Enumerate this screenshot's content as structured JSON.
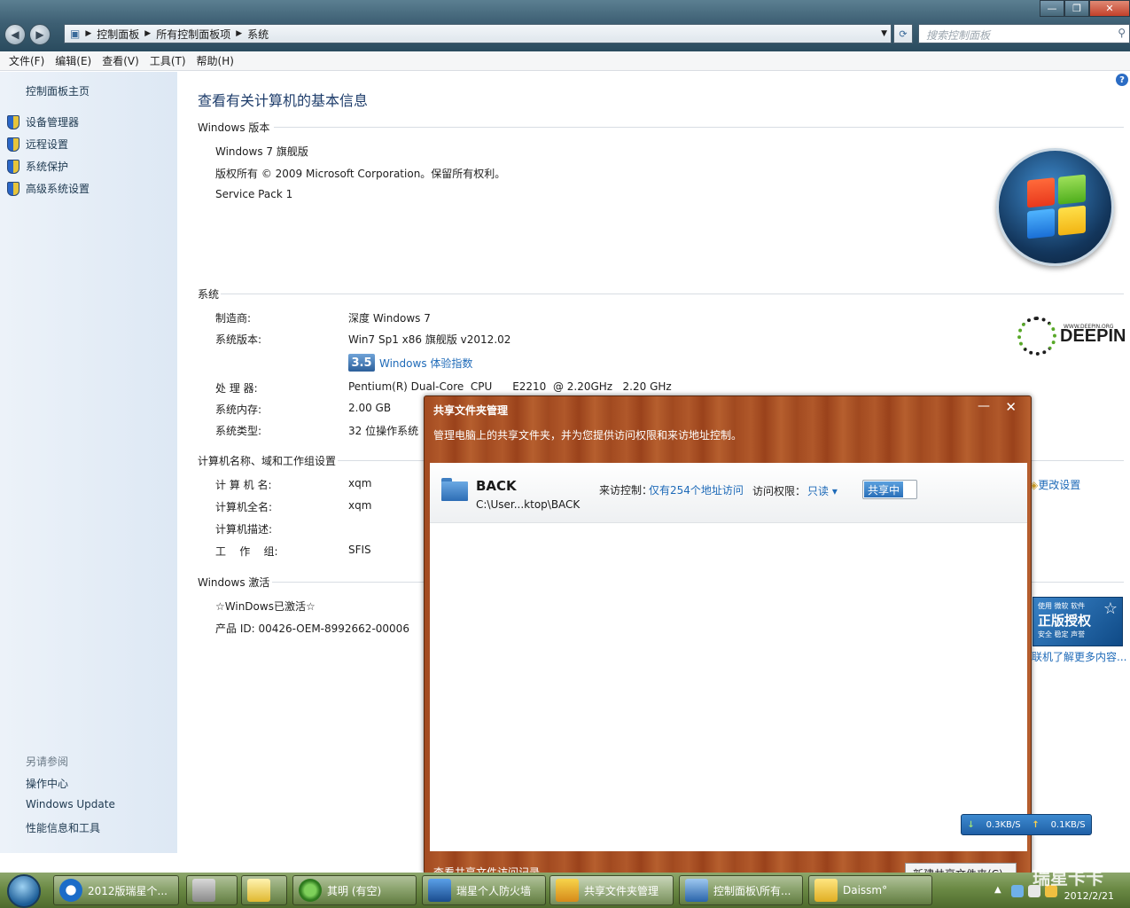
{
  "address": {
    "crumbs": [
      "控制面板",
      "所有控制面板项",
      "系统"
    ],
    "search_placeholder": "搜索控制面板"
  },
  "menu": [
    "文件(F)",
    "编辑(E)",
    "查看(V)",
    "工具(T)",
    "帮助(H)"
  ],
  "sidebar": {
    "home": "控制面板主页",
    "items": [
      "设备管理器",
      "远程设置",
      "系统保护",
      "高级系统设置"
    ],
    "see_also_head": "另请参阅",
    "see_also": [
      "操作中心",
      "Windows Update",
      "性能信息和工具"
    ]
  },
  "main": {
    "title": "查看有关计算机的基本信息",
    "edition": {
      "head": "Windows 版本",
      "name": "Windows 7 旗舰版",
      "copyright": "版权所有 © 2009 Microsoft Corporation。保留所有权利。",
      "sp": "Service Pack 1"
    },
    "system": {
      "head": "系统",
      "manufacturer_label": "制造商:",
      "manufacturer": "深度 Windows 7",
      "version_label": "系统版本:",
      "version": "Win7 Sp1 x86 旗舰版 v2012.02",
      "wei_score": "3.5",
      "wei_link": "Windows 体验指数",
      "cpu_label": "处 理 器:",
      "cpu": "Pentium(R) Dual-Core  CPU      E2210  @ 2.20GHz   2.20 GHz",
      "ram_label": "系统内存:",
      "ram": "2.00 GB",
      "type_label": "系统类型:",
      "type": "32 位操作系统"
    },
    "computer": {
      "head": "计算机名称、域和工作组设置",
      "name_label": "计 算 机 名:",
      "name": "xqm",
      "fullname_label": "计算机全名:",
      "fullname": "xqm",
      "desc_label": "计算机描述:",
      "workgroup_label": "工    作    组:",
      "workgroup": "SFIS",
      "change_link": "更改设置"
    },
    "activation": {
      "head": "Windows 激活",
      "status": "☆WinDows已激活☆",
      "product_id": "产品 ID: 00426-OEM-8992662-00006"
    },
    "deepin_text": "DEEPIN",
    "deepin_org": "WWW.DEEPIN.ORG",
    "genuine": {
      "line1": "使用 微软 软件",
      "line2": "正版授权",
      "line3": "安全 稳定 声誉"
    },
    "more_info": "联机了解更多内容..."
  },
  "dialog": {
    "title": "共享文件夹管理",
    "subtitle": "管理电脑上的共享文件夹，并为您提供访问权限和来访地址控制。",
    "share": {
      "name": "BACK",
      "path": "C:\\User...ktop\\BACK",
      "access_label": "来访控制：",
      "access_value": "仅有254个地址访问",
      "perm_label": "访问权限：",
      "perm_value": "只读 ▾",
      "status": "共享中"
    },
    "bottom_link": "查看共享文件访问记录",
    "new_button": "新建共享文件夹(C)"
  },
  "speed": {
    "down": "0.3KB/S",
    "up": "0.1KB/S"
  },
  "taskbar": {
    "tasks": [
      "2012版瑞星个...",
      "",
      "",
      "其明 (有空)",
      "瑞星个人防火墙",
      "共享文件夹管理",
      "控制面板\\所有...",
      "Daissm°"
    ],
    "date": "2012/2/21",
    "watermark": "瑞星卡卡"
  }
}
